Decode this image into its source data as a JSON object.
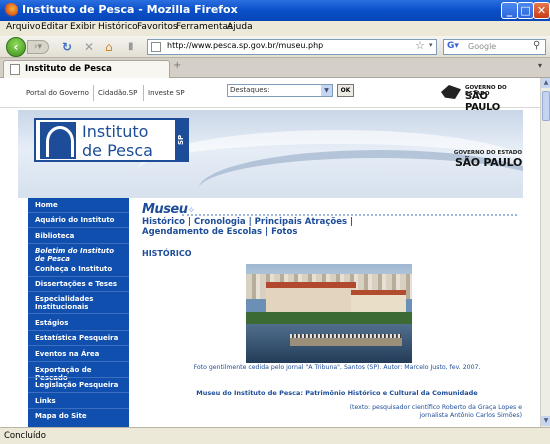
{
  "window": {
    "title": "Instituto de Pesca - Mozilla Firefox",
    "min_symbol": "_",
    "max_symbol": "□",
    "close_symbol": "✕"
  },
  "menu": [
    "Arquivo",
    "Editar",
    "Exibir",
    "Histórico",
    "Favoritos",
    "Ferramentas",
    "Ajuda"
  ],
  "toolbar": {
    "url": "http://www.pesca.sp.gov.br/museu.php",
    "search_placeholder": "Google",
    "search_engine_icon": "google-icon"
  },
  "tab": {
    "label": "Instituto de Pesca",
    "new_tab_symbol": "+"
  },
  "govbar": {
    "links": [
      "Portal do Governo",
      "Cidadão.SP",
      "Investe SP"
    ],
    "select_value": "Destaques:",
    "ok_label": "OK",
    "logo_small": "GOVERNO DO ESTADO",
    "logo_big": "SÃO PAULO"
  },
  "banner": {
    "logo_line1": "Instituto",
    "logo_line2": "de Pesca",
    "logo_sp": "SP",
    "gov_small": "GOVERNO DO ESTADO",
    "gov_big": "SÃO PAULO"
  },
  "sidebar": {
    "items": [
      {
        "label": "Home",
        "italic": false
      },
      {
        "label": "Aquário do Instituto",
        "italic": false
      },
      {
        "label": "Biblioteca",
        "italic": false
      },
      {
        "label": "Boletim do Instituto de Pesca",
        "italic": true
      },
      {
        "label": "Conheça o Instituto",
        "italic": false
      },
      {
        "label": "Dissertações e Teses",
        "italic": false
      },
      {
        "label": "Especialidades Institucionais",
        "italic": false
      },
      {
        "label": "Estágios",
        "italic": false
      },
      {
        "label": "Estatística Pesqueira",
        "italic": false
      },
      {
        "label": "Eventos na Área",
        "italic": false
      },
      {
        "label": "Exportação de Pescado",
        "italic": false
      },
      {
        "label": "Legislação Pesqueira",
        "italic": false
      },
      {
        "label": "Links",
        "italic": false
      },
      {
        "label": "Mapa do Site",
        "italic": false
      }
    ]
  },
  "main": {
    "logo": "Museu",
    "subnav_line1": "Histórico | Cronologia | Principais Atrações |",
    "subnav_line2": "Agendamento de Escolas | Fotos",
    "section_title": "HISTÓRICO",
    "caption": "Foto gentilmente cedida pelo jornal \"A Tribuna\", Santos (SP). Autor: Marcelo Justo, fev. 2007.",
    "museum_line": "Museu do Instituto de Pesca: Patrimônio Histórico e Cultural da Comunidade",
    "credit_line1": "(texto: pesquisador científico Roberto da Graça Lopes e",
    "credit_line2": "jornalista Antônio Carlos Simões)"
  },
  "status": {
    "text": "Concluído"
  }
}
